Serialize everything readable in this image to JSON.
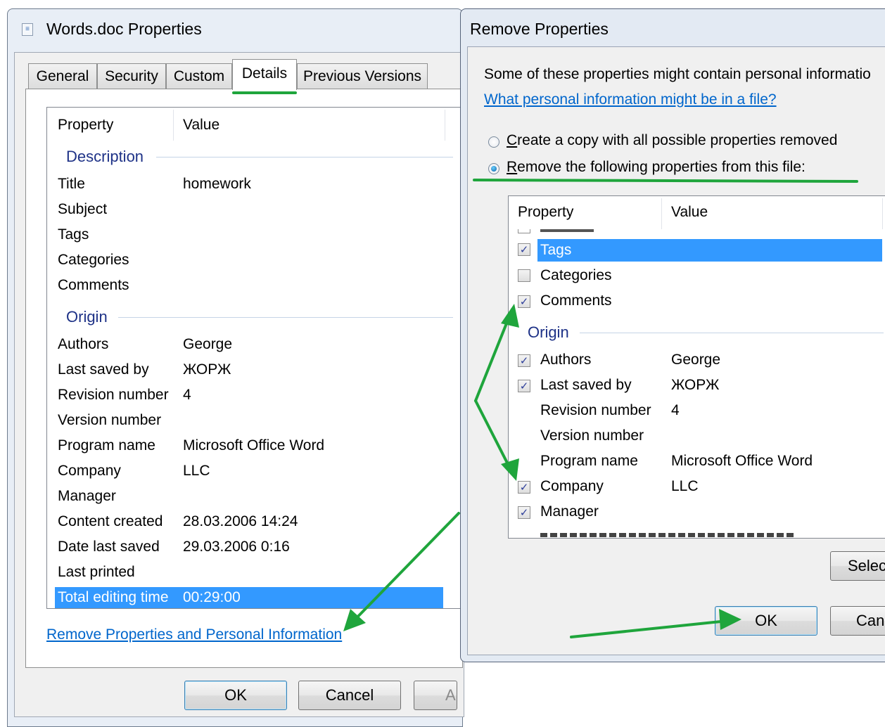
{
  "props_window": {
    "title": "Words.doc Properties",
    "tabs": [
      "General",
      "Security",
      "Custom",
      "Details",
      "Previous Versions"
    ],
    "selected_tab": "Details",
    "columns": [
      "Property",
      "Value"
    ],
    "groups": {
      "description": "Description",
      "origin": "Origin"
    },
    "rows": [
      {
        "property": "Title",
        "value": "homework"
      },
      {
        "property": "Subject",
        "value": ""
      },
      {
        "property": "Tags",
        "value": ""
      },
      {
        "property": "Categories",
        "value": ""
      },
      {
        "property": "Comments",
        "value": ""
      },
      {
        "property": "Authors",
        "value": "George"
      },
      {
        "property": "Last saved by",
        "value": "ЖОРЖ"
      },
      {
        "property": "Revision number",
        "value": "4"
      },
      {
        "property": "Version number",
        "value": ""
      },
      {
        "property": "Program name",
        "value": "Microsoft Office Word"
      },
      {
        "property": "Company",
        "value": "LLC"
      },
      {
        "property": "Manager",
        "value": ""
      },
      {
        "property": "Content created",
        "value": "28.03.2006 14:24"
      },
      {
        "property": "Date last saved",
        "value": "29.03.2006 0:16"
      },
      {
        "property": "Last printed",
        "value": ""
      },
      {
        "property": "Total editing time",
        "value": "00:29:00"
      }
    ],
    "selected_row": "Total editing time",
    "remove_link": "Remove Properties and Personal Information",
    "buttons": {
      "ok": "OK",
      "cancel": "Cancel",
      "apply_partial": "A"
    }
  },
  "remove_window": {
    "title": "Remove Properties",
    "intro": "Some of these properties might contain personal informatio",
    "help_link": "What personal information might be in a file?",
    "options": [
      {
        "label_prefix": "",
        "accel": "C",
        "label_rest": "reate a copy with all possible properties removed",
        "selected": false
      },
      {
        "label_prefix": "",
        "accel": "R",
        "label_rest": "emove the following properties from this file:",
        "selected": true
      }
    ],
    "columns": [
      "Property",
      "Value"
    ],
    "group_origin": "Origin",
    "rows": [
      {
        "property": "Tags",
        "value": "",
        "checkbox": true,
        "checked": true
      },
      {
        "property": "Categories",
        "value": "",
        "checkbox": true,
        "checked": false
      },
      {
        "property": "Comments",
        "value": "",
        "checkbox": true,
        "checked": true
      },
      {
        "property": "Authors",
        "value": "George",
        "checkbox": true,
        "checked": true
      },
      {
        "property": "Last saved by",
        "value": "ЖОРЖ",
        "checkbox": true,
        "checked": true
      },
      {
        "property": "Revision number",
        "value": "4",
        "checkbox": false,
        "checked": false
      },
      {
        "property": "Version number",
        "value": "",
        "checkbox": false,
        "checked": false
      },
      {
        "property": "Program name",
        "value": "Microsoft Office Word",
        "checkbox": false,
        "checked": false
      },
      {
        "property": "Company",
        "value": "LLC",
        "checkbox": true,
        "checked": true
      },
      {
        "property": "Manager",
        "value": "",
        "checkbox": true,
        "checked": true
      }
    ],
    "selected_row": "Tags",
    "buttons": {
      "select_partial": "Selec",
      "ok": "OK",
      "cancel_partial": "Canc"
    }
  },
  "colors": {
    "selection": "#3399ff",
    "link": "#0066cc",
    "group_header": "#1e3287",
    "annotation_green": "#1fa53c"
  }
}
